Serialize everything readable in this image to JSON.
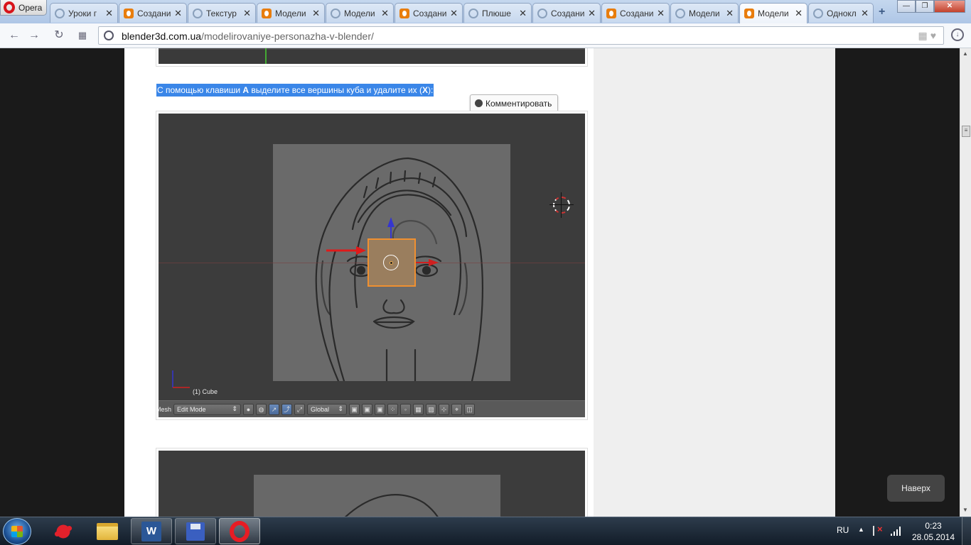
{
  "browser": {
    "app_name": "Opera",
    "tabs": [
      {
        "label": "Уроки г",
        "icon": "loading-icon"
      },
      {
        "label": "Создани",
        "icon": "blender-icon"
      },
      {
        "label": "Текстур",
        "icon": "loading-icon"
      },
      {
        "label": "Модели",
        "icon": "blender-icon"
      },
      {
        "label": "Модели",
        "icon": "loading-icon"
      },
      {
        "label": "Создани",
        "icon": "blender-icon"
      },
      {
        "label": "Плюше",
        "icon": "loading-icon"
      },
      {
        "label": "Создани",
        "icon": "loading-icon"
      },
      {
        "label": "Создани",
        "icon": "blender-icon"
      },
      {
        "label": "Модели",
        "icon": "loading-icon"
      },
      {
        "label": "Модели",
        "icon": "blender-icon",
        "active": true
      },
      {
        "label": "Однокл",
        "icon": "loading-icon"
      }
    ],
    "new_tab": "+",
    "address": {
      "host": "blender3d.com.ua",
      "path": "/modelirovaniye-personazha-v-blender/"
    }
  },
  "article": {
    "para_parts": {
      "p1": "С помощью клавиши ",
      "key_a": "A",
      "p2": " выделите все вершины куба и удалите их (",
      "key_x": "X",
      "p3": "):"
    },
    "comment_button": "Комментировать",
    "viewport": {
      "object_label": "(1) Cube",
      "mesh_label": "Mesh",
      "mode": "Edit Mode",
      "orientation": "Global"
    },
    "back_to_top": "Наверх"
  },
  "taskbar": {
    "language": "RU",
    "time": "0:23",
    "date": "28.05.2014",
    "apps": [
      "splat-app-icon",
      "folder-icon",
      "word-icon",
      "floppy-save-icon",
      "opera-icon"
    ]
  },
  "colors": {
    "selection": "#3a86e8",
    "cube_outline": "#f09030",
    "x_axis": "#e02020",
    "z_axis": "#3030d0"
  }
}
